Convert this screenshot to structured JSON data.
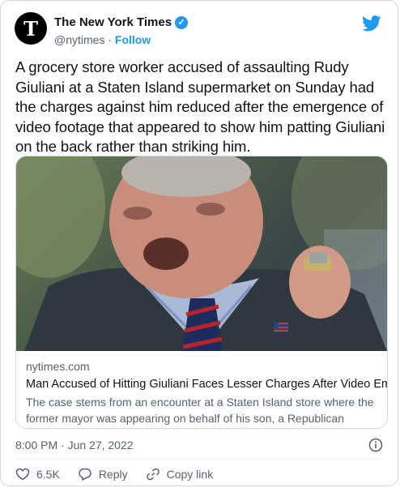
{
  "header": {
    "account_name": "The New York Times",
    "handle": "@nytimes",
    "separator": "·",
    "follow_label": "Follow",
    "avatar_glyph": "T"
  },
  "tweet": {
    "text": "A grocery store worker accused of assaulting Rudy Giuliani at a Staten Island supermarket on Sunday had the charges against him reduced after the emergence of video footage that appeared to show him patting Giuliani on the back rather than striking him."
  },
  "link_card": {
    "domain": "nytimes.com",
    "headline": "Man Accused of Hitting Giuliani Faces Lesser Charges After Video Emerges",
    "description": "The case stems from an encounter at a Staten Island store where the former mayor was appearing on behalf of his son, a Republican candidat..."
  },
  "meta": {
    "timestamp": "8:00 PM · Jun 27, 2022"
  },
  "actions": {
    "like_count": "6.5K",
    "reply_label": "Reply",
    "copy_link_label": "Copy link"
  },
  "colors": {
    "accent": "#1d9bf0",
    "secondary_text": "#536471",
    "border": "#cfd9de"
  },
  "icons": [
    "verified-badge-icon",
    "twitter-bird-icon",
    "info-icon",
    "heart-icon",
    "reply-icon",
    "link-icon"
  ]
}
